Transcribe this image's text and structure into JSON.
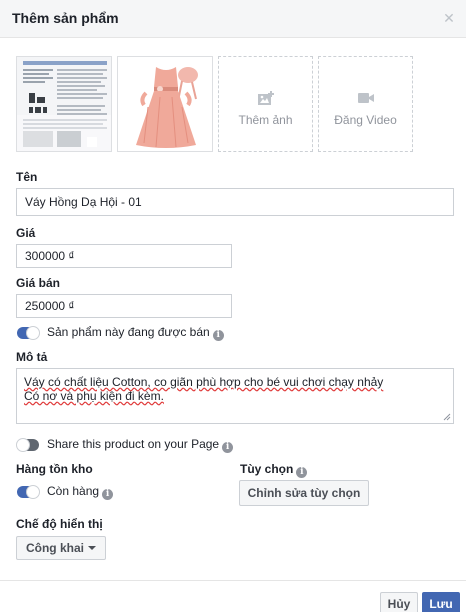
{
  "dialog": {
    "title": "Thêm sản phẩm",
    "close_icon": "close-icon"
  },
  "media": {
    "thumb1_icon": "document-screenshot-image",
    "thumb2_icon": "pink-dress-image",
    "add_photo_icon": "add-photo-icon",
    "add_photo_label": "Thêm ảnh",
    "add_video_icon": "video-camera-icon",
    "add_video_label": "Đăng Video"
  },
  "fields": {
    "name_label": "Tên",
    "name_value": "Váy Hồng Dạ Hội - 01",
    "price_label": "Giá",
    "price_value": "300000 ₫",
    "sale_price_label": "Giá bán",
    "sale_price_value": "250000 ₫",
    "on_sale_toggle": {
      "on": true,
      "text": "Sản phẩm này đang được bán"
    },
    "description_label": "Mô tả",
    "description_lines": [
      "Váy có chất liệu Cotton, co giãn phù hợp cho bé vui chơi chạy nhảy",
      "Có nơ và phụ kiện đi kèm."
    ],
    "share_toggle": {
      "on": false,
      "text": "Share this product on your Page"
    }
  },
  "inventory": {
    "label": "Hàng tồn kho",
    "toggle": {
      "on": true,
      "text": "Còn hàng"
    }
  },
  "options": {
    "label": "Tùy chọn",
    "edit_button": "Chỉnh sửa tùy chọn"
  },
  "visibility": {
    "label": "Chế độ hiển thị",
    "value": "Công khai"
  },
  "footer": {
    "cancel": "Hủy",
    "save": "Lưu"
  },
  "colors": {
    "accent": "#4267b2",
    "header_bg": "#f5f6f7",
    "dress_pink": "#f0a99a"
  }
}
